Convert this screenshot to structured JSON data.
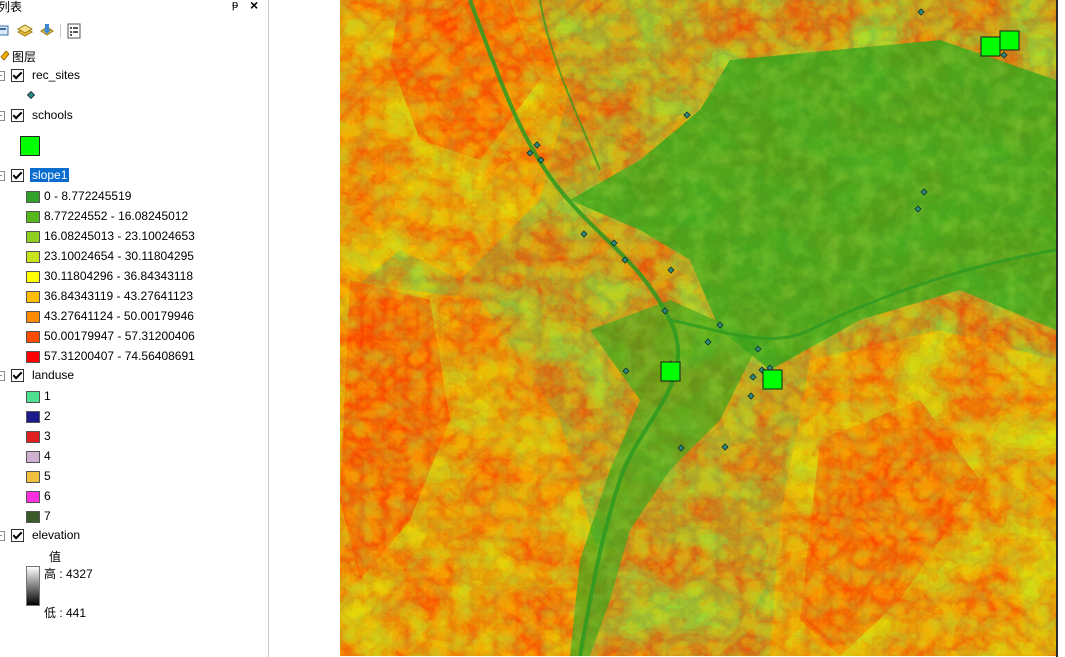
{
  "toc": {
    "title": "列表",
    "root_label": "图层",
    "pin_glyph": "ᵽ",
    "close_glyph": "×"
  },
  "layers": [
    {
      "name": "rec_sites",
      "checked": true,
      "symbol": "small-diamond-point",
      "color": "#2d8a7a"
    },
    {
      "name": "schools",
      "checked": true,
      "symbol": "green-square",
      "color": "#00ff00"
    },
    {
      "name": "slope1",
      "checked": true,
      "selected": true,
      "classes": [
        {
          "label": "0 - 8.772245519",
          "color": "#33a02c"
        },
        {
          "label": "8.77224552 - 16.08245012",
          "color": "#57b81c"
        },
        {
          "label": "16.08245013 - 23.10024653",
          "color": "#8fcf1d"
        },
        {
          "label": "23.10024654 - 30.11804295",
          "color": "#c7e21a"
        },
        {
          "label": "30.11804296 - 36.84343118",
          "color": "#ffff00"
        },
        {
          "label": "36.84343119 - 43.27641123",
          "color": "#ffbf00"
        },
        {
          "label": "43.27641124 - 50.00179946",
          "color": "#ff8c00"
        },
        {
          "label": "50.00179947 - 57.31200406",
          "color": "#ff4d00"
        },
        {
          "label": "57.31200407 - 74.56408691",
          "color": "#ff0000"
        }
      ]
    },
    {
      "name": "landuse",
      "checked": true,
      "classes": [
        {
          "label": "1",
          "color": "#4ee090"
        },
        {
          "label": "2",
          "color": "#1a1a8c"
        },
        {
          "label": "3",
          "color": "#e02020"
        },
        {
          "label": "4",
          "color": "#d0b0d0"
        },
        {
          "label": "5",
          "color": "#f0c040"
        },
        {
          "label": "6",
          "color": "#ff30e0"
        },
        {
          "label": "7",
          "color": "#3a5a2a"
        }
      ]
    },
    {
      "name": "elevation",
      "checked": true,
      "value_header": "值",
      "high_label": "高 : 4327",
      "low_label": "低 : 441"
    }
  ],
  "map": {
    "point_color": "#2d8a7a",
    "school_color": "#00ff00"
  }
}
